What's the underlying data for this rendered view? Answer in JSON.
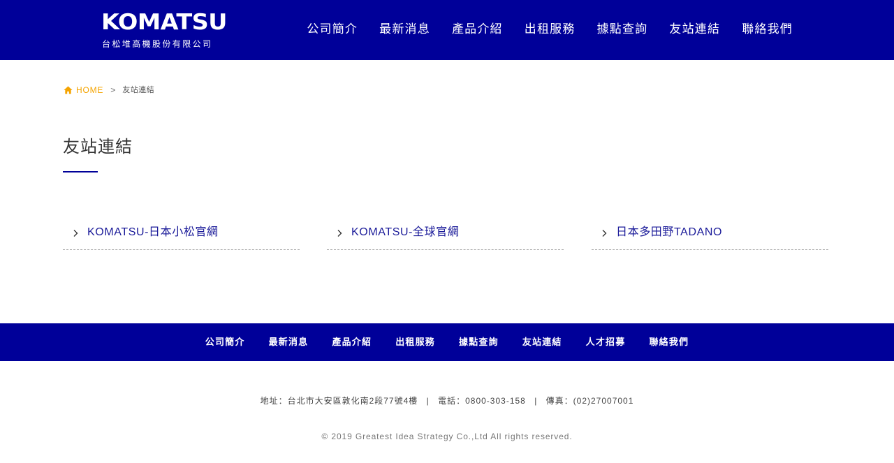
{
  "header": {
    "logo_text": "KOMATSU",
    "logo_subtitle": "台松堆高機股份有限公司",
    "nav": [
      "公司簡介",
      "最新消息",
      "產品介紹",
      "出租服務",
      "據點查詢",
      "友站連結",
      "聯絡我們"
    ]
  },
  "breadcrumb": {
    "home": "HOME",
    "separator": ">",
    "current": "友站連結"
  },
  "page": {
    "title": "友站連結"
  },
  "links": [
    {
      "label": "KOMATSU-日本小松官網"
    },
    {
      "label": "KOMATSU-全球官網"
    },
    {
      "label": "日本多田野TADANO"
    }
  ],
  "footer_nav": [
    "公司簡介",
    "最新消息",
    "產品介紹",
    "出租服務",
    "據點查詢",
    "友站連結",
    "人才招募",
    "聯絡我們"
  ],
  "footer": {
    "address": "地址：台北市大安區敦化南2段77號4樓",
    "sep": "|",
    "phone": "電話：0800-303-158",
    "fax": "傳真：(02)27007001",
    "copyright": "© 2019 Greatest Idea Strategy Co.,Ltd All rights reserved."
  },
  "colors": {
    "brand_blue": "#000099",
    "link_blue": "#1a1a99",
    "home_orange": "#f5a400"
  },
  "icons": {
    "home": "home-icon",
    "chevron": "chevron-right-icon"
  }
}
